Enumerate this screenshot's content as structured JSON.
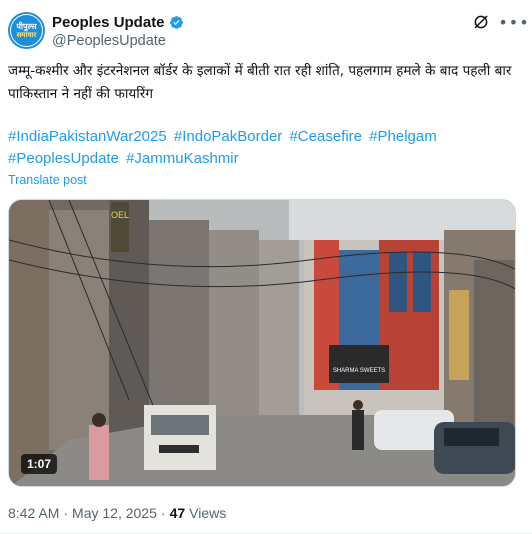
{
  "author": {
    "display_name": "Peoples Update",
    "handle": "@PeoplesUpdate",
    "avatar_line1": "पीपुल्स",
    "avatar_line2": "समाचार",
    "verified_color": "#1d9bf0"
  },
  "header_icons": [
    "grok-icon",
    "more-icon"
  ],
  "tweet": {
    "text": "जम्मू-कश्मीर और इंटरनेशनल बॉर्डर के इलाकों में बीती रात रही शांति, पहलगाम हमले के बाद पहली बार पाकिस्तान ने नहीं की फायरिंग",
    "hashtags": [
      "#IndiaPakistanWar2025",
      "#IndoPakBorder",
      "#Ceasefire",
      "#Phelgam",
      "#PeoplesUpdate",
      "#JammuKashmir"
    ],
    "translate_label": "Translate post"
  },
  "media": {
    "duration": "1:07",
    "sign_oel": "OEL",
    "sign_shop": "SHARMA SWEETS"
  },
  "meta": {
    "time": "8:42 AM",
    "separator1": "·",
    "date": "May 12, 2025",
    "separator2": "·",
    "views_count": "47",
    "views_label": "Views"
  },
  "colors": {
    "accent": "#1d9bf0",
    "text": "#0f1419",
    "secondary": "#536471"
  }
}
